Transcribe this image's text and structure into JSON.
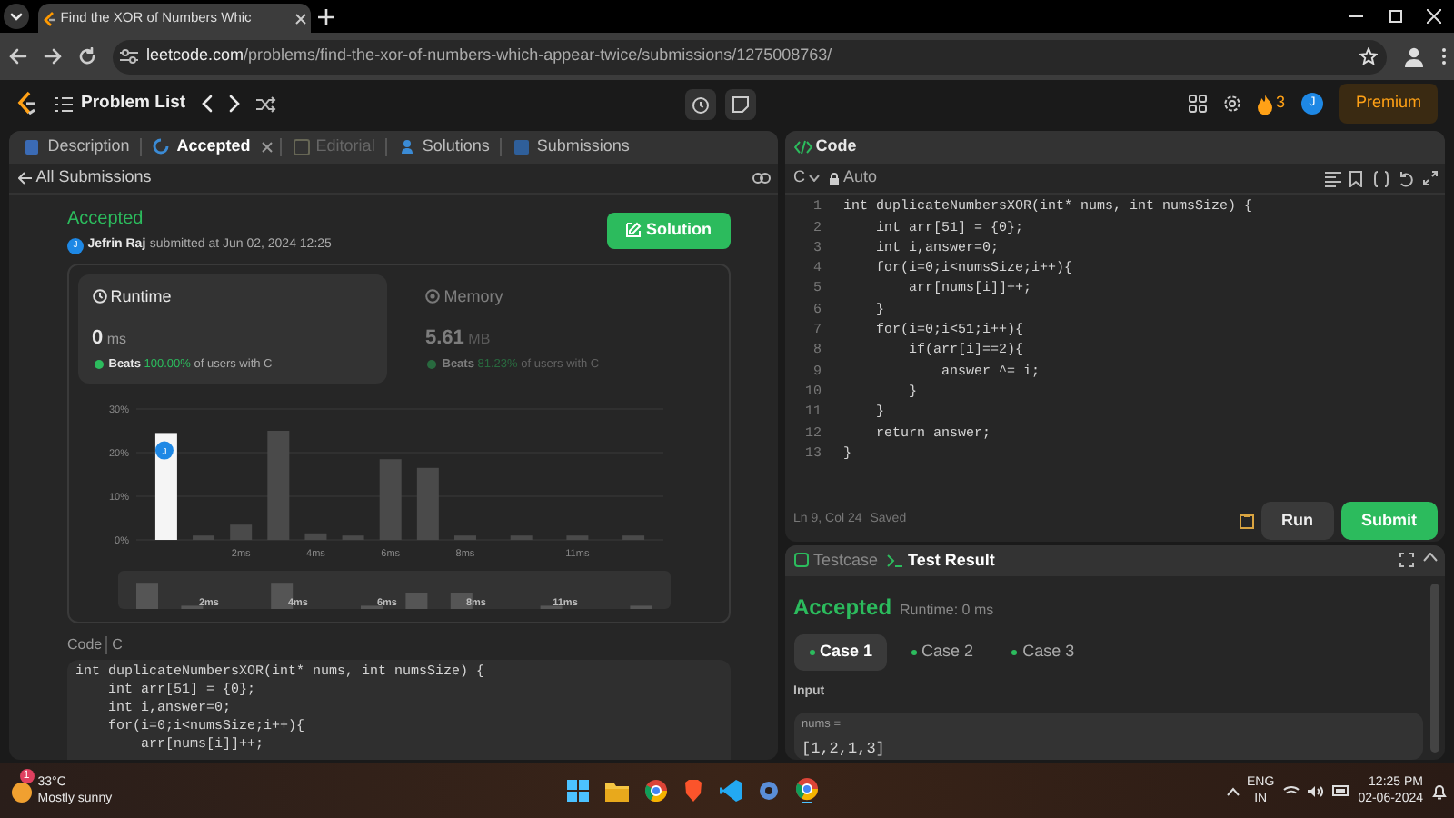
{
  "browser": {
    "tab_title": "Find the XOR of Numbers Whic",
    "url_host": "leetcode.com",
    "url_path": "/problems/find-the-xor-of-numbers-which-appear-twice/submissions/1275008763/"
  },
  "nav": {
    "problem_list": "Problem List",
    "streak": "3",
    "avatar": "J",
    "premium": "Premium"
  },
  "left_tabs": [
    {
      "label": "Description",
      "selected": false,
      "disabled": false,
      "closable": false
    },
    {
      "label": "Accepted",
      "selected": true,
      "disabled": false,
      "closable": true
    },
    {
      "label": "Editorial",
      "selected": false,
      "disabled": true,
      "closable": false
    },
    {
      "label": "Solutions",
      "selected": false,
      "disabled": false,
      "closable": false
    },
    {
      "label": "Submissions",
      "selected": false,
      "disabled": false,
      "closable": false
    }
  ],
  "back_link": "All Submissions",
  "submission": {
    "status": "Accepted",
    "user": "Jefrin Raj",
    "avatar": "J",
    "submitted": "submitted at Jun 02, 2024 12:25",
    "solution_button": "Solution"
  },
  "metrics": [
    {
      "kind": "runtime",
      "label": "Runtime",
      "value": "0",
      "unit": "ms",
      "beats": "Beats",
      "percent": "100.00%",
      "suffix": "of users with C",
      "selected": true
    },
    {
      "kind": "memory",
      "label": "Memory",
      "value": "5.61",
      "unit": "MB",
      "beats": "Beats",
      "percent": "81.23%",
      "suffix": "of users with C",
      "selected": false
    }
  ],
  "chart_data": {
    "type": "bar",
    "x": [
      0,
      1,
      2,
      3,
      4,
      5,
      6,
      7,
      8,
      9.5,
      11,
      12.5
    ],
    "xlim": [
      -0.8,
      13.3
    ],
    "values": [
      24.5,
      1,
      3.5,
      25,
      1.5,
      1,
      18.5,
      16.5,
      1,
      1,
      1,
      1
    ],
    "xticks": [
      {
        "value": 2,
        "label": "2ms"
      },
      {
        "value": 4,
        "label": "4ms"
      },
      {
        "value": 6,
        "label": "6ms"
      },
      {
        "value": 8,
        "label": "8ms"
      },
      {
        "value": 11,
        "label": "11ms"
      }
    ],
    "yticks": [
      {
        "value": 0,
        "label": "0%"
      },
      {
        "value": 10,
        "label": "10%"
      },
      {
        "value": 20,
        "label": "20%"
      },
      {
        "value": 30,
        "label": "30%"
      }
    ],
    "ylim": [
      0,
      30
    ],
    "annotations": [
      {
        "x": 0,
        "y": 20.5,
        "text": "J"
      }
    ]
  },
  "overview_labels": [
    "2ms",
    "4ms",
    "6ms",
    "8ms",
    "11ms"
  ],
  "code_header": {
    "label": "Code",
    "language": "C"
  },
  "snippet_lines": [
    "int duplicateNumbersXOR(int* nums, int numsSize) {",
    "    int arr[51] = {0};",
    "    int i,answer=0;",
    "    for(i=0;i<numsSize;i++){",
    "        arr[nums[i]]++;"
  ],
  "editor": {
    "title": "Code",
    "language": "C",
    "mode": "Auto",
    "status": "Ln 9, Col 24",
    "saved": "Saved",
    "run": "Run",
    "submit": "Submit",
    "lines": [
      {
        "no": "1",
        "code": "int duplicateNumbersXOR(int* nums, int numsSize) {"
      },
      {
        "no": "2",
        "code": "    int arr[51] = {0};"
      },
      {
        "no": "3",
        "code": "    int i,answer=0;"
      },
      {
        "no": "4",
        "code": "    for(i=0;i<numsSize;i++){"
      },
      {
        "no": "5",
        "code": "        arr[nums[i]]++;"
      },
      {
        "no": "6",
        "code": "    }"
      },
      {
        "no": "7",
        "code": "    for(i=0;i<51;i++){"
      },
      {
        "no": "8",
        "code": "        if(arr[i]==2){"
      },
      {
        "no": "9",
        "code": "            answer ^= i;"
      },
      {
        "no": "10",
        "code": "        }"
      },
      {
        "no": "11",
        "code": "    }"
      },
      {
        "no": "12",
        "code": "    return answer;"
      },
      {
        "no": "13",
        "code": "}"
      }
    ]
  },
  "result_tabs": [
    {
      "label": "Testcase",
      "selected": false
    },
    {
      "label": "Test Result",
      "selected": true
    }
  ],
  "result": {
    "status": "Accepted",
    "runtime": "Runtime: 0 ms",
    "cases": [
      {
        "label": "Case 1",
        "selected": true
      },
      {
        "label": "Case 2",
        "selected": false
      },
      {
        "label": "Case 3",
        "selected": false
      }
    ],
    "input_label": "Input",
    "param": "nums =",
    "value": "[1,2,1,3]"
  },
  "taskbar": {
    "temp": "33°C",
    "weather": "Mostly sunny",
    "badge": "1",
    "lang": "ENG",
    "region": "IN",
    "time": "12:25 PM",
    "date": "02-06-2024"
  }
}
